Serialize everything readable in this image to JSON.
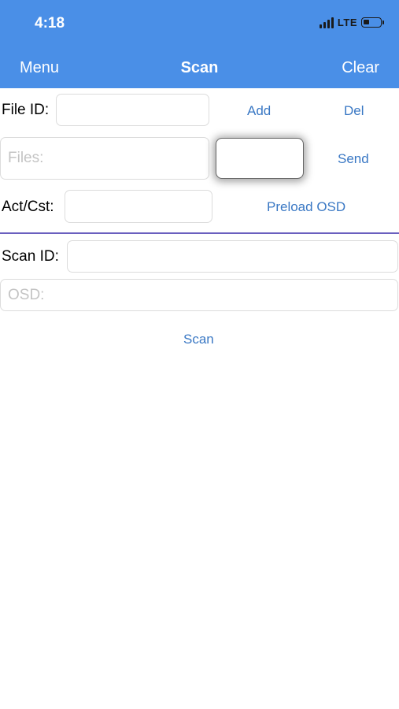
{
  "status_bar": {
    "time": "4:18",
    "network": "LTE",
    "battery_level": 0.35
  },
  "nav": {
    "menu_label": "Menu",
    "title": "Scan",
    "clear_label": "Clear"
  },
  "form": {
    "file_id_label": "File ID:",
    "file_id_value": "",
    "add_label": "Add",
    "del_label": "Del",
    "files_placeholder": "Files:",
    "send_label": "Send",
    "act_cst_label": "Act/Cst:",
    "act_cst_value": "",
    "preload_label": "Preload OSD",
    "scan_id_label": "Scan ID:",
    "scan_id_value": "",
    "osd_placeholder": "OSD:",
    "scan_label": "Scan"
  },
  "colors": {
    "header_bg": "#4a8fe7",
    "link": "#3a78c4",
    "divider": "#6a5fbf"
  },
  "icons": [
    "signal-icon",
    "battery-icon"
  ]
}
